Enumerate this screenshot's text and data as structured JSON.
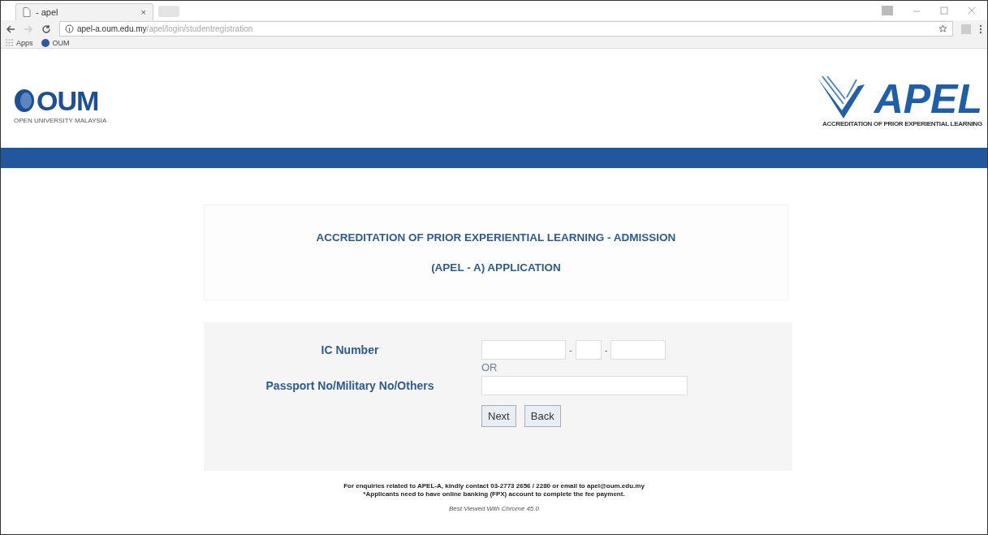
{
  "browser": {
    "tab_title": "- apel",
    "tab_close": "×",
    "url_host": "apel-a.oum.edu.my",
    "url_path": "/apel/login/studentregistration",
    "bookmarks": [
      "Apps",
      "OUM"
    ]
  },
  "header": {
    "left_logo": {
      "name": "OUM",
      "tagline": "OPEN UNIVERSITY MALAYSIA"
    },
    "right_logo": {
      "name": "APEL",
      "tagline": "ACCREDITATION OF PRIOR EXPERIENTIAL LEARNING"
    }
  },
  "title_lines": [
    "ACCREDITATION OF PRIOR EXPERIENTIAL LEARNING - ADMISSION",
    "(APEL - A) APPLICATION"
  ],
  "form": {
    "ic_label": "IC Number",
    "ic_separators": [
      "-",
      "-"
    ],
    "or_text": "OR",
    "passport_label": "Passport No/Military No/Others",
    "buttons": [
      "Next",
      "Back"
    ]
  },
  "footer": {
    "lines": [
      "For enquiries related to APEL-A, kindly contact 03-2773 2656 / 2280 or email to apel@oum.edu.my",
      "*Applicants need to have online banking (FPX) account to complete the fee payment."
    ],
    "note": "Best Viewed With Chrome 45.0"
  }
}
